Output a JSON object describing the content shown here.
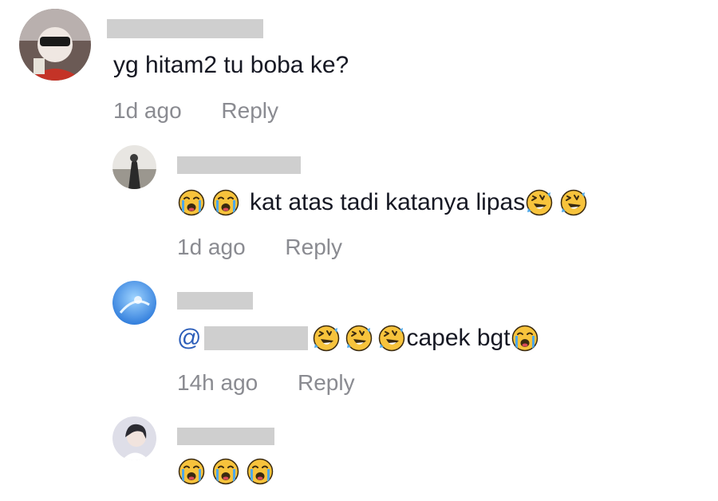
{
  "comments": [
    {
      "username": "",
      "text": "yg hitam2 tu boba ke?",
      "time": "1d ago",
      "reply_label": "Reply"
    },
    {
      "username": "",
      "text": "kat atas tadi katanya lipas",
      "time": "1d ago",
      "reply_label": "Reply"
    },
    {
      "username": "",
      "mention": "@",
      "text": "capek bgt",
      "time": "14h ago",
      "reply_label": "Reply"
    },
    {
      "username": ""
    }
  ],
  "icons": {
    "crying": "loudly-crying-face-icon",
    "laughing": "rolling-on-floor-laughing-icon"
  },
  "colors": {
    "text": "#161823",
    "meta": "#8a8b91",
    "mention": "#2b5db9",
    "redaction": "#cfcfcf",
    "emoji_yellow": "#f7c33c"
  }
}
